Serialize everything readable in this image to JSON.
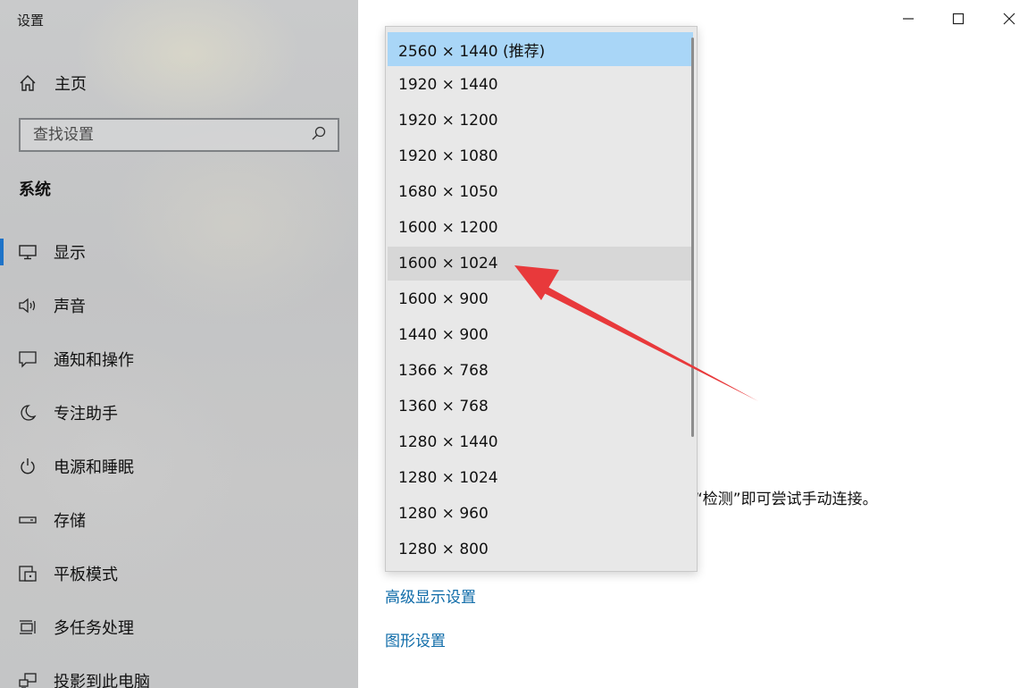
{
  "app": {
    "title": "设置"
  },
  "sidebar": {
    "home_label": "主页",
    "search_placeholder": "查找设置",
    "section_title": "系统",
    "items": [
      {
        "label": "显示",
        "icon": "monitor-icon",
        "active": true
      },
      {
        "label": "声音",
        "icon": "speaker-icon"
      },
      {
        "label": "通知和操作",
        "icon": "notification-icon"
      },
      {
        "label": "专注助手",
        "icon": "moon-icon"
      },
      {
        "label": "电源和睡眠",
        "icon": "power-icon"
      },
      {
        "label": "存储",
        "icon": "storage-icon"
      },
      {
        "label": "平板模式",
        "icon": "tablet-icon"
      },
      {
        "label": "多任务处理",
        "icon": "multitask-icon"
      },
      {
        "label": "投影到此电脑",
        "icon": "project-icon"
      }
    ]
  },
  "main": {
    "partial_text": "“检测”即可尝试手动连接。",
    "advanced_display_link": "高级显示设置",
    "graphics_link": "图形设置"
  },
  "resolution_dropdown": {
    "selected": "2560 × 1440 (推荐)",
    "hovered": "1600 × 1024",
    "options": [
      "2560 × 1440 (推荐)",
      "1920 × 1440",
      "1920 × 1200",
      "1920 × 1080",
      "1680 × 1050",
      "1600 × 1200",
      "1600 × 1024",
      "1600 × 900",
      "1440 × 900",
      "1366 × 768",
      "1360 × 768",
      "1280 × 1440",
      "1280 × 1024",
      "1280 × 960",
      "1280 × 800"
    ]
  },
  "colors": {
    "accent": "#1e73c8",
    "link": "#0e6ba8",
    "selected_option": "#a9d6f7",
    "annotation_arrow": "#e8393b"
  }
}
